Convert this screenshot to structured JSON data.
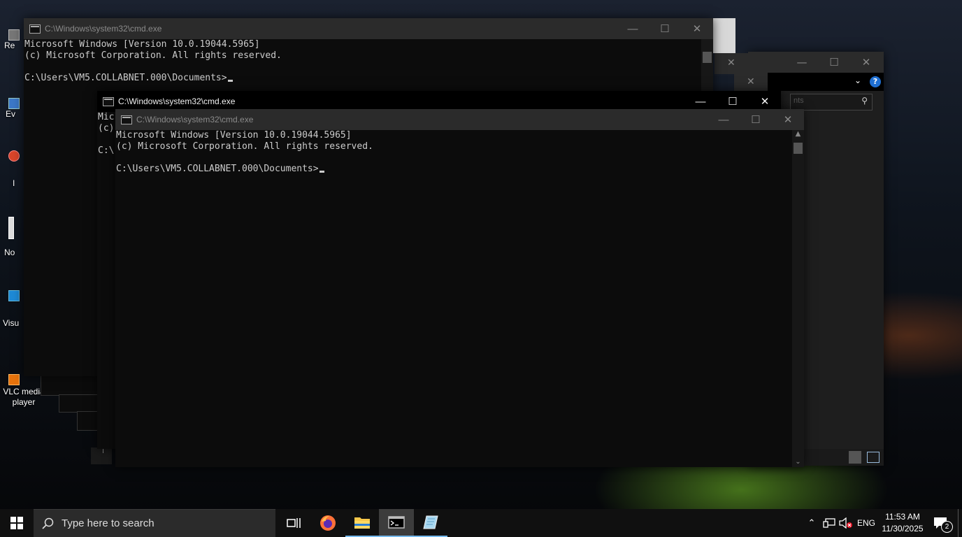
{
  "desktop": {
    "icons": [
      {
        "label": "Re",
        "name": "recycle-bin"
      },
      {
        "label": "Ev",
        "name": "event-viewer"
      },
      {
        "label": "I",
        "name": "app-shortcut"
      },
      {
        "label": "No",
        "name": "notepad"
      },
      {
        "label": "Visu",
        "name": "visual-studio"
      },
      {
        "label": "VLC media player",
        "name": "vlc-media-player"
      }
    ]
  },
  "windows": {
    "back": {
      "title": "C:\\Windows\\system32\\cmd.exe",
      "line1": "Microsoft Windows [Version 10.0.19044.5965]",
      "line2": "(c) Microsoft Corporation. All rights reserved.",
      "prompt": "C:\\Users\\VM5.COLLABNET.000\\Documents>"
    },
    "middle": {
      "title": "C:\\Windows\\system32\\cmd.exe",
      "line1": "Mic",
      "line2": "(c)",
      "prompt": "C:\\"
    },
    "front": {
      "title": "C:\\Windows\\system32\\cmd.exe",
      "line1": "Microsoft Windows [Version 10.0.19044.5965]",
      "line2": "(c) Microsoft Corporation. All rights reserved.",
      "prompt": "C:\\Users\\VM5.COLLABNET.000\\Documents>"
    }
  },
  "explorer_search": {
    "placeholder_fragment": "nts"
  },
  "taskbar": {
    "search_placeholder": "Type here to search",
    "language": "ENG",
    "time": "11:53 AM",
    "date": "11/30/2025",
    "notification_count": "2"
  },
  "colors": {
    "taskbar_bg": "#101010",
    "console_bg": "#0c0c0c",
    "console_text": "#cccccc",
    "active_title_bg": "#000000",
    "inactive_title_bg": "#2b2b2b",
    "help_blue": "#1f6fd1"
  }
}
